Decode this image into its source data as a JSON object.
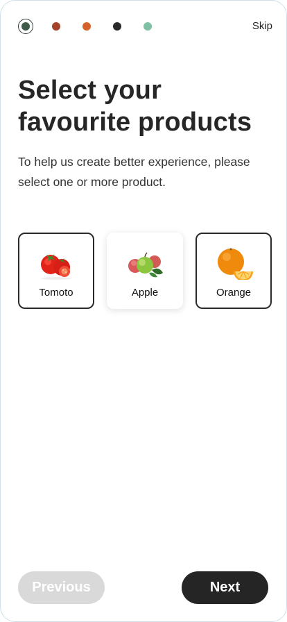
{
  "progress": {
    "dots": [
      {
        "color": "#3f5a48",
        "active": true
      },
      {
        "color": "#a3432c",
        "active": false
      },
      {
        "color": "#d4622a",
        "active": false
      },
      {
        "color": "#2a2a2a",
        "active": false
      },
      {
        "color": "#7fbfa4",
        "active": false
      }
    ],
    "current_step": 1,
    "total_steps": 5
  },
  "header": {
    "skip_label": "Skip"
  },
  "main": {
    "title_line1": "Select your",
    "title_line2": "favourite products",
    "subtitle": "To help us create better experience, please select one or more product."
  },
  "products": [
    {
      "label": "Tomoto",
      "icon": "tomato-image",
      "selected": true
    },
    {
      "label": "Apple",
      "icon": "apple-image",
      "selected": false
    },
    {
      "label": "Orange",
      "icon": "orange-image",
      "selected": true
    }
  ],
  "footer": {
    "previous_label": "Previous",
    "next_label": "Next"
  },
  "colors": {
    "primary": "#252525",
    "disabled": "#d9d9d9"
  }
}
